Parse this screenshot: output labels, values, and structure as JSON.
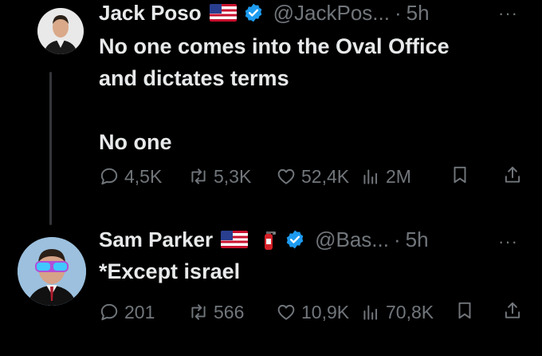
{
  "colors": {
    "background": "#000000",
    "text": "#e7e9ea",
    "muted": "#71767b",
    "verified": "#1d9bf0",
    "thread_line": "#333639"
  },
  "posts": [
    {
      "author": {
        "name": "Jack Poso",
        "handle": "@JackPos...",
        "separator": "·",
        "time": "5h",
        "badges": [
          "us-flag-icon",
          "verified-badge-icon"
        ]
      },
      "text": "No one comes into the Oval Office\nand dictates terms\n\nNo one",
      "actions": {
        "replies": "4,5K",
        "reposts": "5,3K",
        "likes": "52,4K",
        "views": "2M"
      },
      "more": "···"
    },
    {
      "author": {
        "name": "Sam Parker",
        "handle": "@Bas...",
        "separator": "·",
        "time": "5h",
        "badges": [
          "us-flag-icon",
          "fire-extinguisher-icon",
          "verified-badge-icon"
        ]
      },
      "text": "*Except israel",
      "actions": {
        "replies": "201",
        "reposts": "566",
        "likes": "10,9K",
        "views": "70,8K"
      },
      "more": "···"
    }
  ]
}
